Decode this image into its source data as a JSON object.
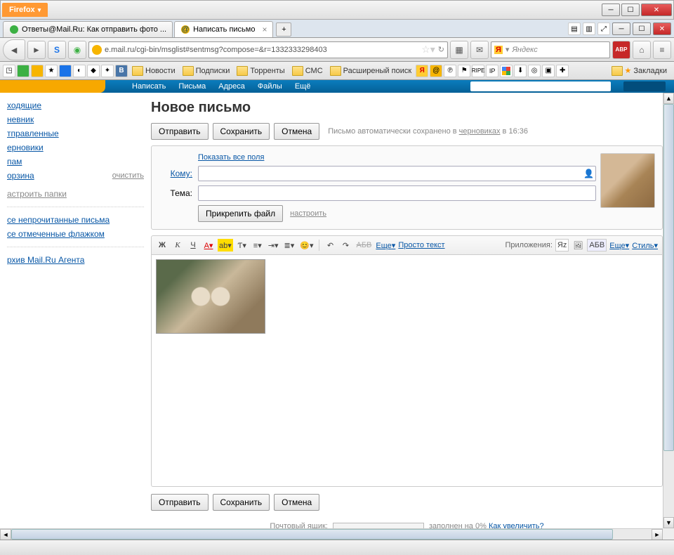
{
  "window": {
    "firefox_label": "Firefox",
    "tabs": [
      {
        "title": "Ответы@Mail.Ru: Как отправить фото ...",
        "favicon_color": "#3cb043"
      },
      {
        "title": "Написать письмо",
        "favicon_color": "#f7b500"
      }
    ],
    "new_tab_plus": "+"
  },
  "nav": {
    "url": "e.mail.ru/cgi-bin/msglist#sentmsg?compose=&r=1332333298403",
    "search_placeholder": "Яндекс"
  },
  "bookmarks": {
    "folders": [
      "Новости",
      "Подписки",
      "Торренты",
      "СМС",
      "Расширеный поиск"
    ],
    "right_label": "Закладки"
  },
  "mail_menu": {
    "items": [
      "Написать",
      "Письма",
      "Адреса",
      "Файлы",
      "Ещё"
    ]
  },
  "sidebar": {
    "items": [
      "ходящие",
      "невник",
      "тправленные",
      "ерновики",
      "пам",
      "орзина"
    ],
    "clean": "очистить",
    "settings": "астроить папки",
    "unread": "се непрочитанные письма",
    "flagged": "се отмеченные флажком",
    "archive": "рхив Mail.Ru Агента"
  },
  "compose": {
    "heading": "Новое письмо",
    "send": "Отправить",
    "save": "Сохранить",
    "cancel": "Отмена",
    "autosave_prefix": "Письмо автоматически сохранено в ",
    "autosave_link": "черновиках",
    "autosave_time": " в 16:36",
    "show_all_fields": "Показать все поля",
    "to_label": "Кому:",
    "subject_label": "Тема:",
    "attach_btn": "Прикрепить файл",
    "attach_settings": "настроить"
  },
  "toolbar": {
    "bold": "Ж",
    "italic": "К",
    "underline": "Ч",
    "more": "Еще",
    "plaintext": "Просто текст",
    "apps_label": "Приложения:",
    "more2": "Еще",
    "style": "Стиль"
  },
  "footer": {
    "label": "Почтовый ящик: ",
    "filled": " заполнен на 0% ",
    "increase": "Как увеличить?"
  }
}
